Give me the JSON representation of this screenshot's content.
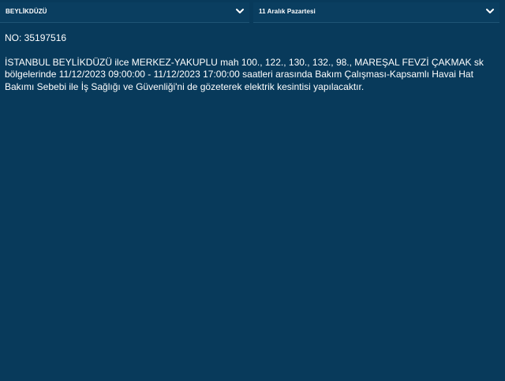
{
  "filters": {
    "district": {
      "selected": "BEYLİKDÜZÜ"
    },
    "date": {
      "selected": "11 Aralık Pazartesi"
    }
  },
  "notice": {
    "number_text": "NO: 35197516",
    "text": "İSTANBUL BEYLİKDÜZÜ ilce MERKEZ-YAKUPLU mah 100., 122., 130., 132., 98., MAREŞAL FEVZİ ÇAKMAK sk bölgelerinde 11/12/2023 09:00:00 - 11/12/2023 17:00:00 saatleri arasında Bakım Çalışması-Kapsamlı Havai Hat Bakımı Sebebi ile İş Sağlığı ve Güvenliği'ni de gözeterek elektrik kesintisi yapılacaktır."
  },
  "icons": {
    "district_select": "chevron-down-icon",
    "date_select": "chevron-down-icon"
  }
}
